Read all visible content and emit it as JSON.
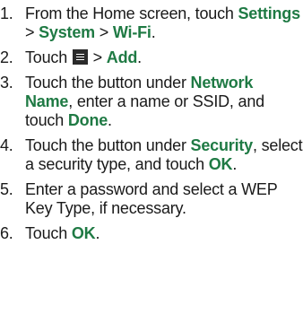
{
  "steps": [
    {
      "num": "1.",
      "a": "From the Home screen, touch ",
      "b1": "Settings",
      "c": " > ",
      "b2": "System",
      "d": " > ",
      "b3": "Wi-Fi",
      "e": "."
    },
    {
      "num": "2.",
      "a": "Touch ",
      "icon": "menu-icon",
      "b": " > ",
      "b1": "Add",
      "c": "."
    },
    {
      "num": "3.",
      "a": "Touch the button under ",
      "b1": "Network Name",
      "b": ", enter a name or SSID, and touch ",
      "b2": "Done",
      "c": "."
    },
    {
      "num": "4.",
      "a": "Touch the button under ",
      "b1": "Security",
      "b": ", select a security type, and touch ",
      "b2": "OK",
      "c": "."
    },
    {
      "num": "5.",
      "a": "Enter a password and select a WEP Key Type, if necessary."
    },
    {
      "num": "6.",
      "a": "Touch ",
      "b1": "OK",
      "c": "."
    }
  ],
  "colors": {
    "emphasis": "#1f7a44",
    "text": "#1a1a1a"
  }
}
